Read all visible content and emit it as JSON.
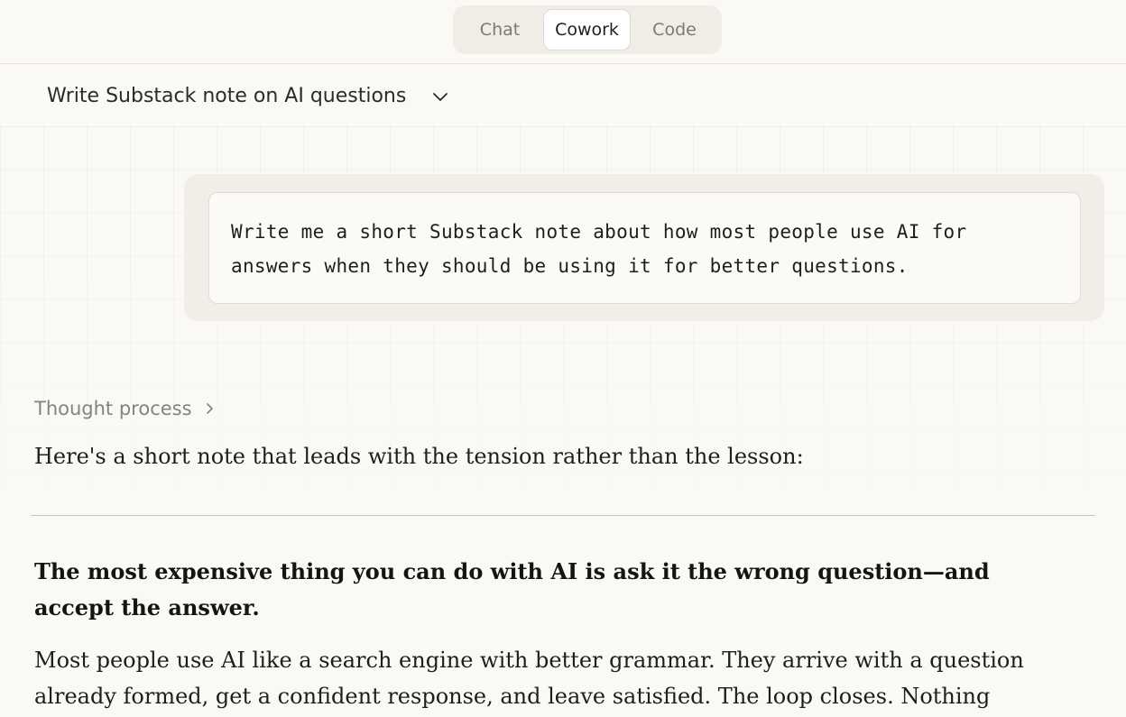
{
  "modes": {
    "chat": "Chat",
    "cowork": "Cowork",
    "code": "Code",
    "active": "Cowork"
  },
  "conversation": {
    "title": "Write Substack note on AI questions",
    "title_icon": "chevron-down-icon"
  },
  "user_message": {
    "line1": "Write me a short Substack note about how most people use AI for",
    "line2": "answers when they should be using it for better questions."
  },
  "assistant": {
    "thought_label": "Thought process",
    "thought_icon": "chevron-right-icon",
    "intro": "Here's a short note that leads with the tension rather than the lesson:",
    "note_heading": "The most expensive thing you can do with AI is ask it the wrong question—and accept the answer.",
    "note_body": "Most people use AI like a search engine with better grammar. They arrive with a question already formed, get a confident response, and leave satisfied. The loop closes. Nothing"
  },
  "colors": {
    "background": "#faf9f5",
    "bubble": "#f0eee7",
    "muted_text": "#85837d"
  }
}
